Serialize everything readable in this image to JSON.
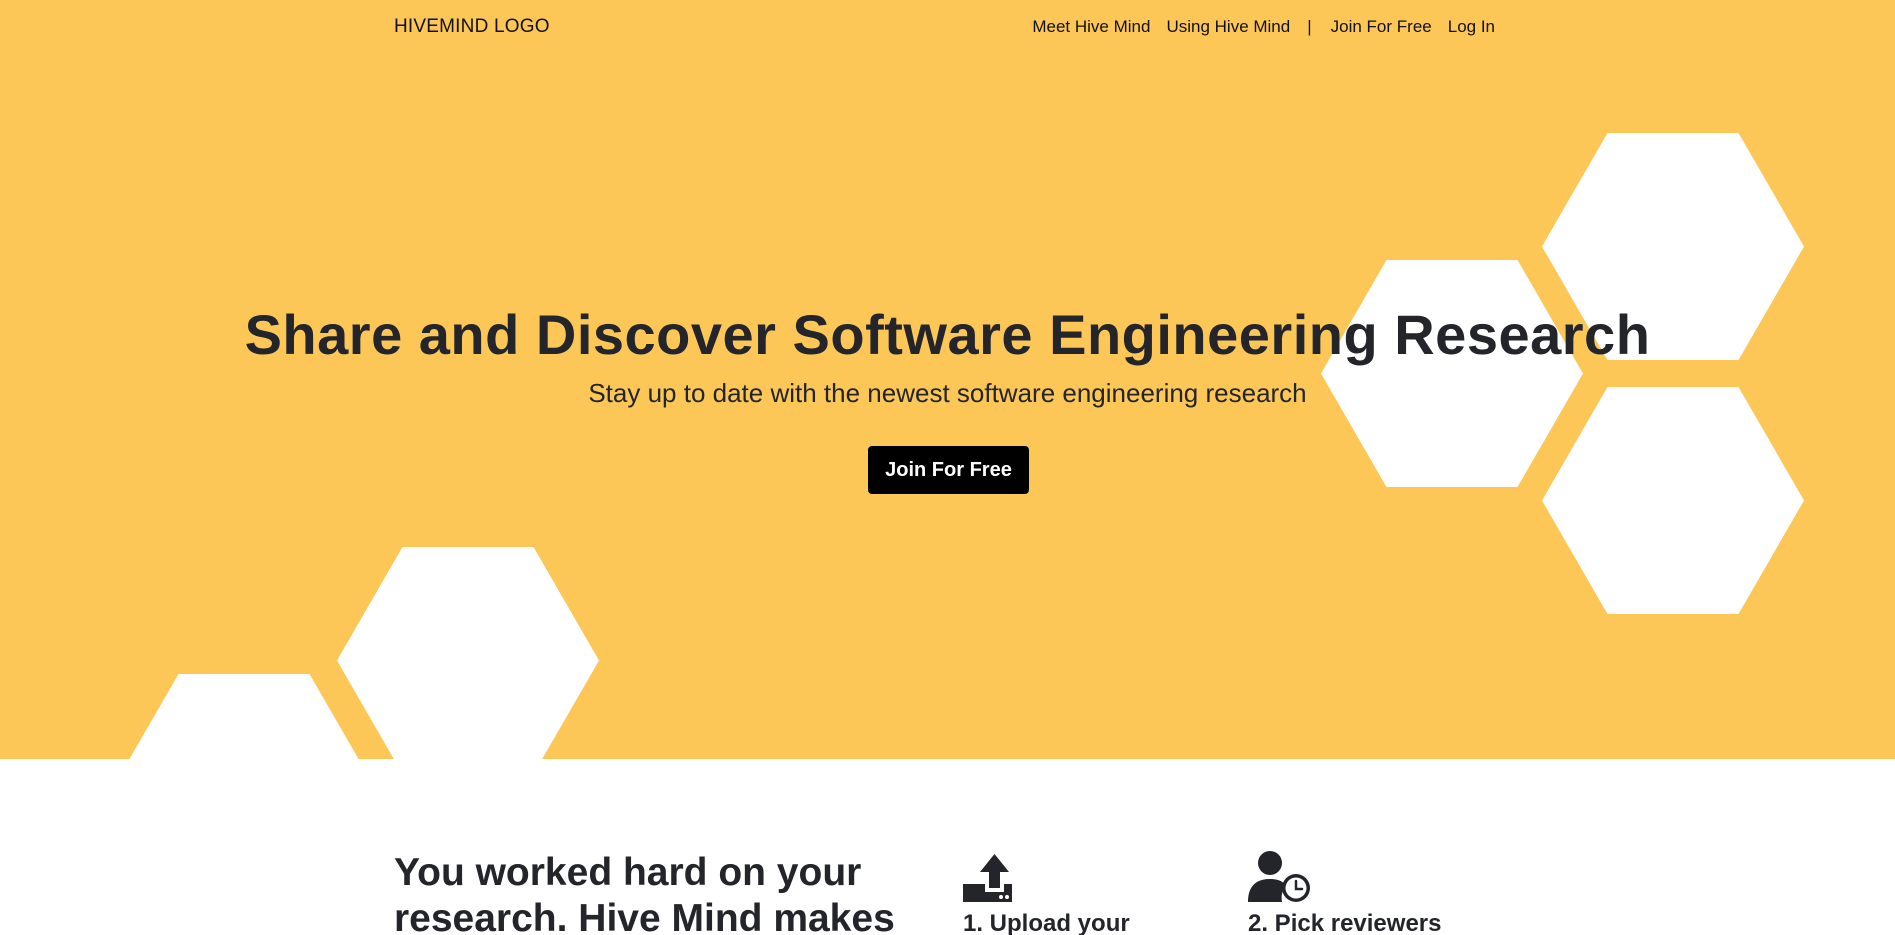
{
  "header": {
    "logo": "HIVEMIND LOGO",
    "nav": {
      "meet": "Meet Hive Mind",
      "using": "Using Hive Mind",
      "separator": "|",
      "join": "Join For Free",
      "login": "Log In"
    }
  },
  "hero": {
    "title": "Share and Discover Software Engineering Research",
    "subtitle": "Stay up to date with the newest software engineering research",
    "cta": "Join For Free"
  },
  "features": {
    "headline": "You worked hard on your research. Hive Mind makes",
    "steps": [
      {
        "icon": "upload-icon",
        "title": "1. Upload your"
      },
      {
        "icon": "user-clock-icon",
        "title": "2. Pick reviewers"
      }
    ]
  },
  "colors": {
    "hero_background": "#fcc757",
    "hexagon": "#ffffff",
    "button": "#000000",
    "text": "#23252b"
  }
}
